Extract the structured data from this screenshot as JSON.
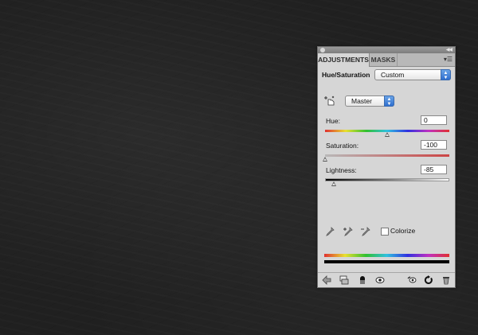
{
  "panel": {
    "tabs": [
      {
        "label": "ADJUSTMENTS",
        "active": true
      },
      {
        "label": "MASKS",
        "active": false
      }
    ],
    "preset_label": "Hue/Saturation",
    "preset_value": "Custom",
    "channel_value": "Master",
    "sliders": [
      {
        "label": "Hue:",
        "value": "0",
        "min": -180,
        "max": 180,
        "numeric": 0
      },
      {
        "label": "Saturation:",
        "value": "-100",
        "min": -100,
        "max": 100,
        "numeric": -100
      },
      {
        "label": "Lightness:",
        "value": "-85",
        "min": -100,
        "max": 100,
        "numeric": -85
      }
    ],
    "colorize_label": "Colorize",
    "colorize_checked": false
  },
  "colors": {
    "panel_bg": "#d6d6d6",
    "accent_blue": "#2f6fcf",
    "saturation_bar": "#cc4444"
  },
  "icons": {
    "titlebar": [
      "close-icon",
      "collapse-icon"
    ],
    "panel_menu": "panel-menu-icon",
    "tool": "targeted-adjustment-icon",
    "eyedroppers": [
      "eyedropper-icon",
      "eyedropper-plus-icon",
      "eyedropper-minus-icon"
    ],
    "bottom": [
      "back-arrow-icon",
      "clip-to-layer-icon",
      "visibility-icon",
      "view-previous-icon",
      "reset-icon",
      "reset-default-icon",
      "trash-icon"
    ]
  }
}
